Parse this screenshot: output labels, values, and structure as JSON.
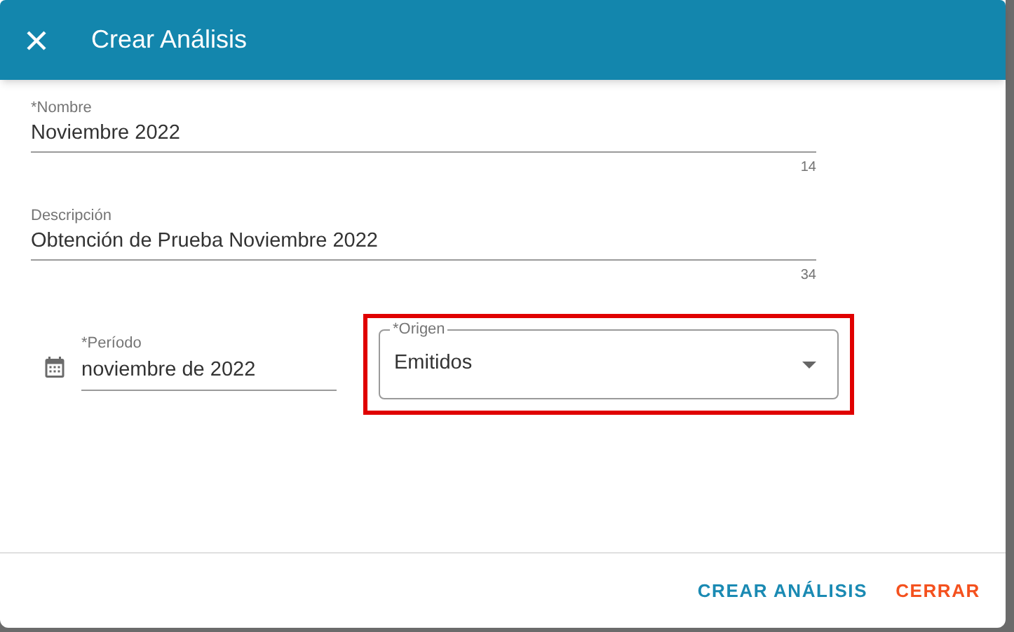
{
  "dialog": {
    "title": "Crear Análisis"
  },
  "fields": [
    {
      "label": "*Nombre",
      "value": "Noviembre 2022",
      "counter": "14"
    },
    {
      "label": "Descripción",
      "value": "Obtención de Prueba Noviembre 2022",
      "counter": "34"
    }
  ],
  "period": {
    "label": "*Período",
    "value": "noviembre de 2022"
  },
  "origin": {
    "label": "*Origen",
    "value": "Emitidos",
    "highlighted": true
  },
  "buttons": [
    {
      "label": "CREAR ANÁLISIS",
      "kind": "primary"
    },
    {
      "label": "CERRAR",
      "kind": "danger"
    }
  ]
}
